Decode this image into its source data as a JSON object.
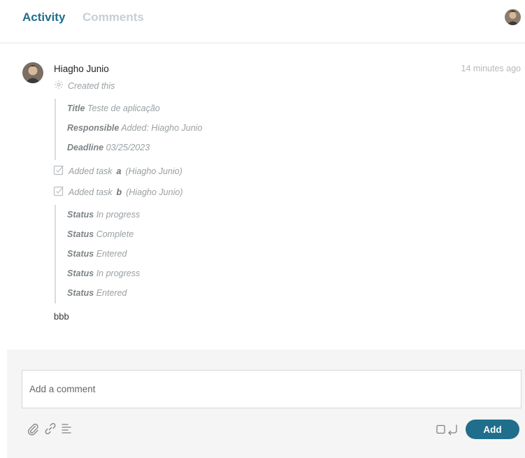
{
  "tabs": [
    {
      "label": "Activity",
      "active": true
    },
    {
      "label": "Comments",
      "active": false
    }
  ],
  "entry": {
    "author": "Hiagho Junio",
    "time": "14 minutes ago",
    "created_label": "Created this",
    "fields": [
      {
        "key": "Title",
        "value": "Teste de aplicação"
      },
      {
        "key": "Responsible",
        "value": "Added: Hiagho Junio"
      },
      {
        "key": "Deadline",
        "value": "03/25/2023"
      }
    ],
    "tasks": [
      {
        "prefix": "Added task",
        "name": "a",
        "suffix": "(Hiagho Junio)"
      },
      {
        "prefix": "Added task",
        "name": "b",
        "suffix": "(Hiagho Junio)"
      }
    ],
    "statuses": [
      {
        "key": "Status",
        "value": "In progress"
      },
      {
        "key": "Status",
        "value": "Complete"
      },
      {
        "key": "Status",
        "value": "Entered"
      },
      {
        "key": "Status",
        "value": "In progress"
      },
      {
        "key": "Status",
        "value": "Entered"
      }
    ],
    "comment": "bbb"
  },
  "composer": {
    "placeholder": "Add a comment",
    "add_label": "Add"
  },
  "icons": {
    "created": "sparkle-icon",
    "task": "checkbox-checked-icon",
    "attach": "paperclip-icon",
    "link": "link-icon",
    "format": "text-format-icon",
    "send_toggle": "enter-to-send-icon"
  },
  "colors": {
    "accent": "#1f6e8c",
    "muted_tab": "#c7ced3",
    "footer_bg": "#f5f5f5"
  }
}
